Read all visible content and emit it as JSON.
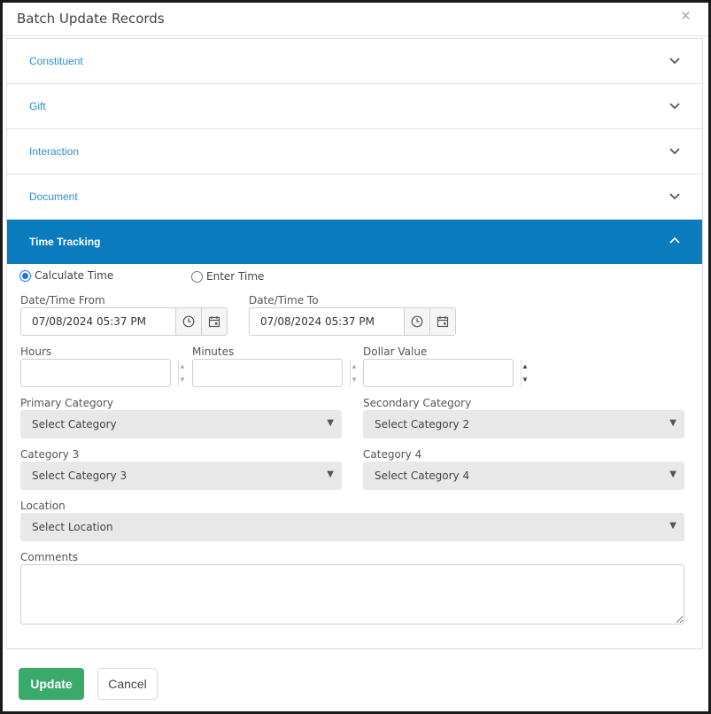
{
  "dialog": {
    "title": "Batch Update Records",
    "close_icon": "×"
  },
  "accordion": [
    {
      "label": "Constituent",
      "expanded": false
    },
    {
      "label": "Gift",
      "expanded": false
    },
    {
      "label": "Interaction",
      "expanded": false
    },
    {
      "label": "Document",
      "expanded": false
    },
    {
      "label": "Time Tracking",
      "expanded": true
    }
  ],
  "time_tracking": {
    "mode_options": [
      {
        "label": "Calculate Time",
        "selected": true
      },
      {
        "label": "Enter Time",
        "selected": false
      }
    ],
    "date_from": {
      "label": "Date/Time From",
      "value": "07/08/2024 05:37 PM"
    },
    "date_to": {
      "label": "Date/Time To",
      "value": "07/08/2024 05:37 PM"
    },
    "hours": {
      "label": "Hours",
      "value": ""
    },
    "minutes": {
      "label": "Minutes",
      "value": ""
    },
    "dollar_value": {
      "label": "Dollar Value",
      "value": ""
    },
    "primary_category": {
      "label": "Primary Category",
      "selected": "Select Category"
    },
    "secondary_category": {
      "label": "Secondary Category",
      "selected": "Select Category 2"
    },
    "category3": {
      "label": "Category 3",
      "selected": "Select Category 3"
    },
    "category4": {
      "label": "Category 4",
      "selected": "Select Category 4"
    },
    "location": {
      "label": "Location",
      "selected": "Select Location"
    },
    "comments": {
      "label": "Comments",
      "value": ""
    }
  },
  "footer": {
    "update_label": "Update",
    "cancel_label": "Cancel"
  },
  "colors": {
    "accent": "#0a7bbd",
    "link": "#2b8fd1",
    "update": "#3aaa6b"
  },
  "icons": [
    "close-icon",
    "chevron-down-icon",
    "chevron-up-icon",
    "clock-icon",
    "calendar-icon",
    "spinner-up-icon",
    "spinner-down-icon",
    "caret-down-icon"
  ]
}
